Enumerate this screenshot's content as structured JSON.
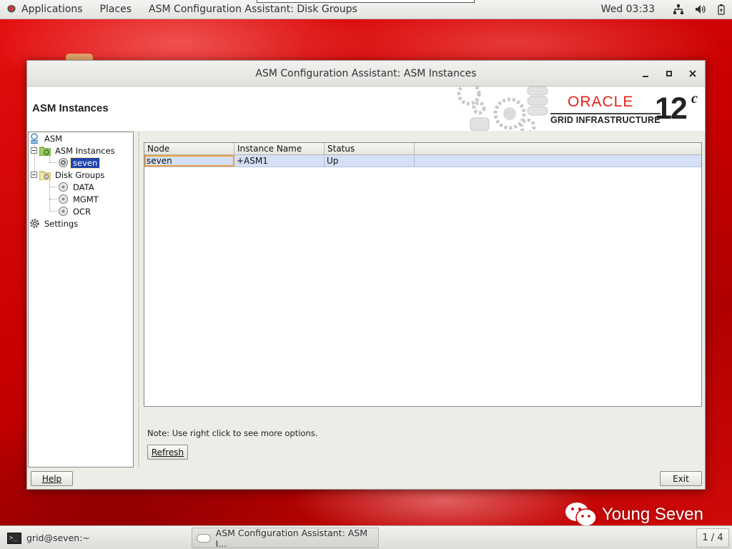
{
  "topbar": {
    "applications": "Applications",
    "places": "Places",
    "active_app": "ASM Configuration Assistant: Disk Groups",
    "clock": "Wed 03:33",
    "tray_icons": [
      "network-icon",
      "volume-icon",
      "battery-icon"
    ]
  },
  "window": {
    "title": "ASM Configuration Assistant: ASM Instances",
    "page_title": "ASM Instances",
    "brand": {
      "oracle": "ORACLE",
      "product": "GRID INFRASTRUCTURE",
      "version": "12",
      "version_suffix": "c"
    }
  },
  "tree": {
    "root": "ASM",
    "asm_instances": "ASM Instances",
    "instance_node": "seven",
    "disk_groups": "Disk Groups",
    "groups": [
      "DATA",
      "MGMT",
      "OCR"
    ],
    "settings": "Settings"
  },
  "table": {
    "columns": [
      "Node",
      "Instance Name",
      "Status"
    ],
    "rows": [
      [
        "seven",
        "+ASM1",
        "Up"
      ]
    ]
  },
  "note": "Note: Use right click to see more options.",
  "buttons": {
    "refresh": "Refresh",
    "help": "Help",
    "exit": "Exit"
  },
  "taskbar": {
    "terminal": "grid@seven:~",
    "asmca": "ASM Configuration Assistant: ASM I...",
    "pager": "1 / 4"
  },
  "watermark": "Young Seven",
  "colors": {
    "desktop_red": "#c80000",
    "oracle_red": "#e2231a",
    "selection_blue": "#1f44a8",
    "row_highlight": "#d4e0f5"
  }
}
